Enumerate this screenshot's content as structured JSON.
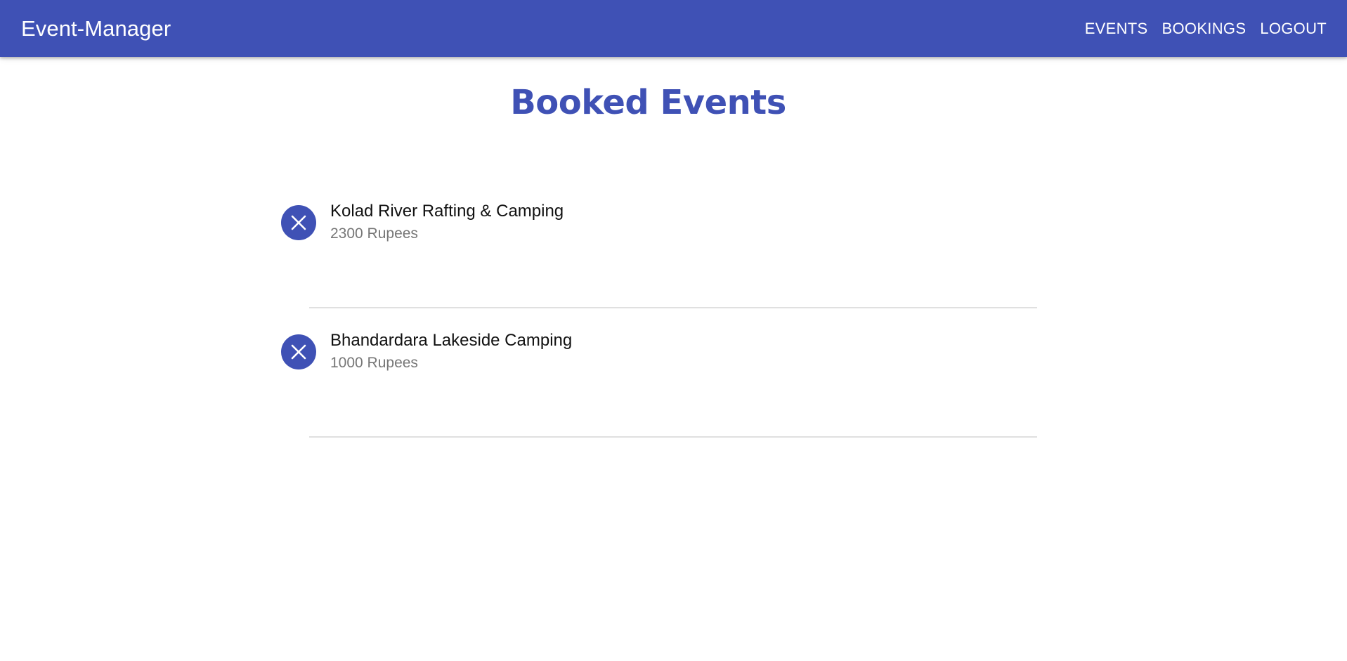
{
  "app": {
    "brand": "Event-Manager",
    "accent_color": "#3f51b5"
  },
  "nav": [
    {
      "label": "EVENTS"
    },
    {
      "label": "BOOKINGS"
    },
    {
      "label": "LOGOUT"
    }
  ],
  "page": {
    "title": "Booked Events"
  },
  "bookings": [
    {
      "icon": "close-icon",
      "title": "Kolad River Rafting & Camping",
      "price": "2300 Rupees"
    },
    {
      "icon": "close-icon",
      "title": "Bhandardara Lakeside Camping",
      "price": "1000 Rupees"
    }
  ]
}
